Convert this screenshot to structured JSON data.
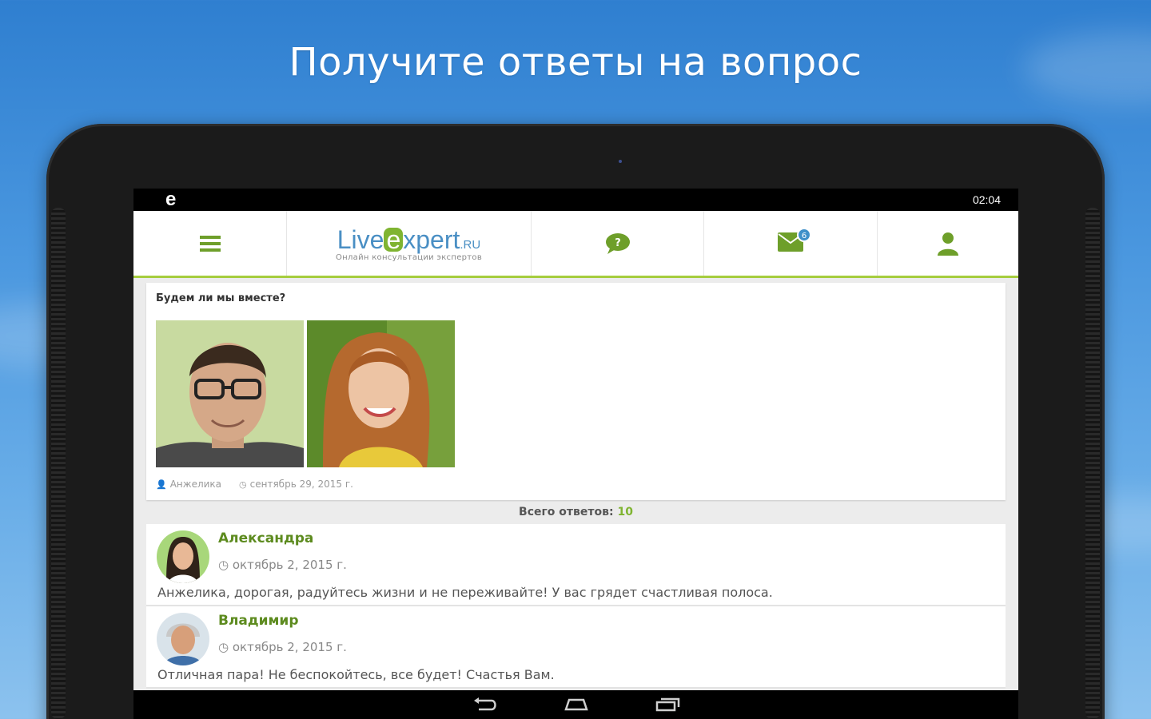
{
  "promo": {
    "headline": "Получите ответы на вопрос"
  },
  "statusbar": {
    "app_letter": "e",
    "time": "02:04"
  },
  "appbar": {
    "logo_live": "Live",
    "logo_e": "e",
    "logo_xpert": "xpert",
    "logo_ru": ".RU",
    "logo_subtitle": "Онлайн консультации экспертов",
    "mail_badge": "6"
  },
  "question": {
    "title": "Будем ли мы вместе?",
    "author": "Анжелика",
    "date": "сентябрь 29, 2015 г."
  },
  "answers_total": {
    "label": "Всего ответов:",
    "count": "10"
  },
  "answers": [
    {
      "name": "Александра",
      "date": "октябрь 2, 2015 г.",
      "text": "Анжелика, дорогая, радуйтесь жизни и не переживайте! У вас грядет счастливая полоса."
    },
    {
      "name": "Владимир",
      "date": "октябрь 2, 2015 г.",
      "text": "Отличная пара! Не беспокойтесь, все будет! Счастья Вам."
    }
  ],
  "colors": {
    "accent_green": "#7fb431",
    "logo_blue": "#4a8fc4",
    "name_green": "#5d8b1f"
  },
  "icons": {
    "menu": "hamburger-icon",
    "chat": "chat-bubble-icon",
    "mail": "envelope-icon",
    "user": "user-icon",
    "back": "back-icon",
    "home": "home-icon",
    "recents": "recents-icon"
  }
}
